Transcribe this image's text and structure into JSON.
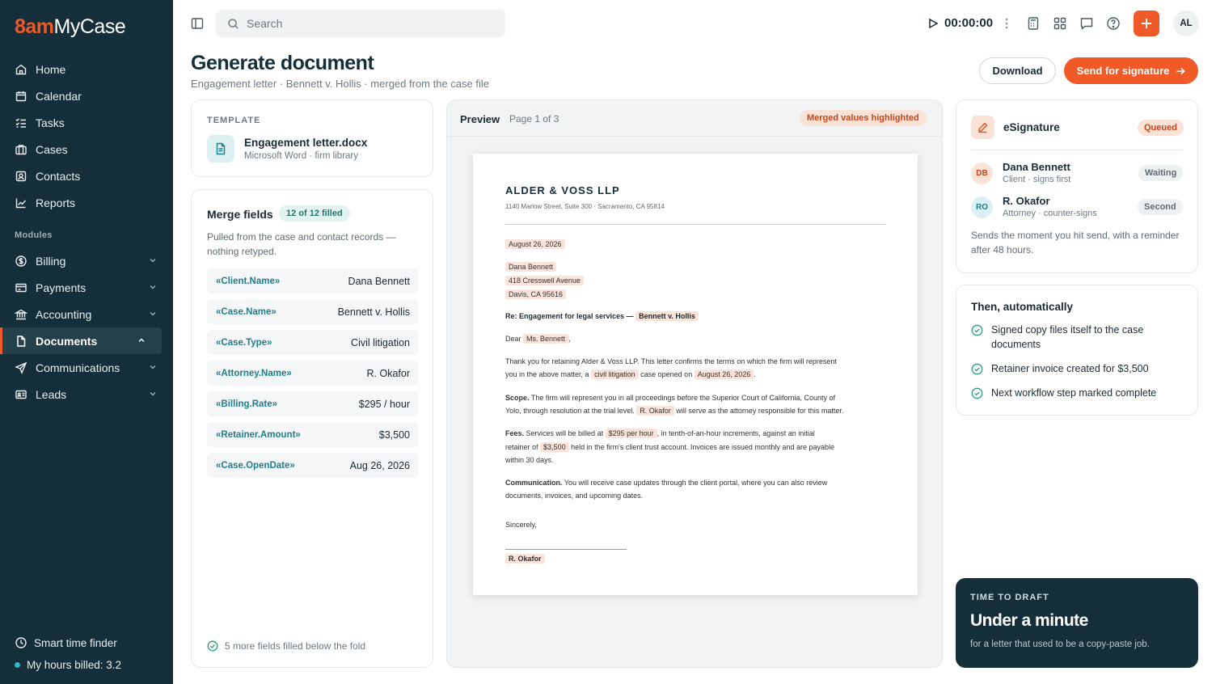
{
  "app": {
    "logo_brand": "8am",
    "logo_product": "MyCase"
  },
  "sidebar": {
    "items": [
      {
        "label": "Home"
      },
      {
        "label": "Calendar"
      },
      {
        "label": "Tasks"
      },
      {
        "label": "Cases"
      },
      {
        "label": "Contacts"
      },
      {
        "label": "Reports"
      }
    ],
    "modules_label": "Modules",
    "modules": [
      {
        "label": "Billing"
      },
      {
        "label": "Payments"
      },
      {
        "label": "Accounting"
      },
      {
        "label": "Documents"
      },
      {
        "label": "Communications"
      },
      {
        "label": "Leads"
      }
    ],
    "smart_time": "Smart time finder",
    "hours_billed": "My hours billed: 3.2"
  },
  "topbar": {
    "search_placeholder": "Search",
    "timer": "00:00:00",
    "avatar": "AL"
  },
  "header": {
    "title": "Generate document",
    "subtitle": "Engagement letter · Bennett v. Hollis · merged from the case file",
    "download_label": "Download",
    "send_label": "Send for signature"
  },
  "template": {
    "caption": "TEMPLATE",
    "name": "Engagement letter.docx",
    "meta": "Microsoft Word · firm library"
  },
  "merge": {
    "title": "Merge fields",
    "badge": "12 of 12 filled",
    "desc": "Pulled from the case and contact records — nothing retyped.",
    "fields": [
      {
        "key": "«Client.Name»",
        "value": "Dana Bennett"
      },
      {
        "key": "«Case.Name»",
        "value": "Bennett v. Hollis"
      },
      {
        "key": "«Case.Type»",
        "value": "Civil litigation"
      },
      {
        "key": "«Attorney.Name»",
        "value": "R. Okafor"
      },
      {
        "key": "«Billing.Rate»",
        "value": "$295 / hour"
      },
      {
        "key": "«Retainer.Amount»",
        "value": "$3,500"
      },
      {
        "key": "«Case.OpenDate»",
        "value": "Aug 26, 2026"
      }
    ],
    "footer": "5 more fields filled below the fold"
  },
  "preview": {
    "title": "Preview",
    "page": "Page 1 of 3",
    "badge": "Merged values highlighted",
    "doc": {
      "firm": "ALDER & VOSS LLP",
      "address": "1140 Marlow Street, Suite 300 · Sacramento, CA 95814",
      "date": "August 26, 2026",
      "client_name": "Dana Bennett",
      "client_street": "418 Cresswell Avenue",
      "client_city": "Davis, CA 95616",
      "re_label": "Re: Engagement for legal services —",
      "re_case": "Bennett v. Hollis",
      "dear": "Dear",
      "salutation_name": "Ms. Bennett",
      "comma": ",",
      "p1_a": "Thank you for retaining Alder & Voss LLP. This letter confirms the terms on which the firm will represent",
      "p1_b": "you in the above matter, a",
      "p1_type": "civil litigation",
      "p1_c": "case opened on",
      "p1_date": "August 26, 2026",
      "period": ".",
      "scope_label": "Scope.",
      "scope_a": "The firm will represent you in all proceedings before the Superior Court of California, County of",
      "scope_b": "Yolo, through resolution at the trial level.",
      "scope_atty": "R. Okafor",
      "scope_c": "will serve as the attorney responsible for this matter.",
      "fees_label": "Fees.",
      "fees_a": "Services will be billed at",
      "fees_rate": "$295 per hour",
      "fees_b": ", in tenth-of-an-hour increments, against an initial",
      "fees_c": "retainer of",
      "fees_amount": "$3,500",
      "fees_d": "held in the firm's client trust account. Invoices are issued monthly and are payable",
      "fees_e": "within 30 days.",
      "comm_label": "Communication.",
      "comm_a": "You will receive case updates through the client portal, where you can also review",
      "comm_b": "documents, invoices, and upcoming dates.",
      "closing": "Sincerely,",
      "signer": "R. Okafor"
    }
  },
  "esign": {
    "title": "eSignature",
    "status": "Queued",
    "signers": [
      {
        "initials": "DB",
        "name": "Dana Bennett",
        "role": "Client · signs first",
        "status": "Waiting"
      },
      {
        "initials": "RO",
        "name": "R. Okafor",
        "role": "Attorney · counter-signs",
        "status": "Second"
      }
    ],
    "note": "Sends the moment you hit send, with a reminder after 48 hours."
  },
  "automation": {
    "title": "Then, automatically",
    "items": [
      "Signed copy files itself to the case documents",
      "Retainer invoice created for $3,500",
      "Next workflow step marked complete"
    ]
  },
  "draft": {
    "caption": "TIME TO DRAFT",
    "headline": "Under a minute",
    "sub": "for a letter that used to be a copy-paste job."
  },
  "colors": {
    "accent": "#f05a28",
    "sidebar": "#152f3a",
    "teal": "#1f7f8c"
  }
}
